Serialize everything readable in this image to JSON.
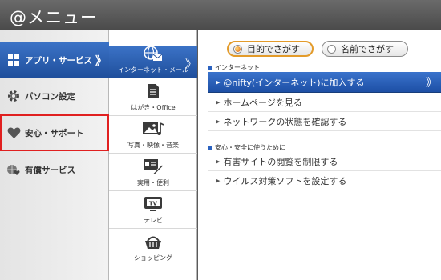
{
  "window": {
    "title": "@メニュー"
  },
  "sidebar": {
    "items": [
      {
        "label": "アプリ・サービス",
        "chevron": "》"
      },
      {
        "label": "パソコン設定"
      },
      {
        "label": "安心・サポート"
      },
      {
        "label": "有償サービス"
      }
    ]
  },
  "categories": [
    {
      "label": "インターネット・メール",
      "icon": "globe-mail-icon",
      "chevron": "》"
    },
    {
      "label": "はがき・Office",
      "icon": "document-icon"
    },
    {
      "label": "写真・映像・音楽",
      "icon": "photo-music-icon"
    },
    {
      "label": "実用・便利",
      "icon": "pen-card-icon"
    },
    {
      "label": "テレビ",
      "icon": "tv-icon"
    },
    {
      "label": "ショッピング",
      "icon": "shopping-basket-icon"
    }
  ],
  "search": {
    "purpose_label": "目的でさがす",
    "name_label": "名前でさがす"
  },
  "sections": [
    {
      "label": "インターネット",
      "items": [
        {
          "label": "@nifty(インターネット)に加入する",
          "chevron": "》"
        },
        {
          "label": "ホームページを見る"
        },
        {
          "label": "ネットワークの状態を確認する"
        }
      ]
    },
    {
      "label": "安心・安全に使うために",
      "items": [
        {
          "label": "有害サイトの閲覧を制限する"
        },
        {
          "label": "ウイルス対策ソフトを設定する"
        }
      ]
    }
  ],
  "colors": {
    "accent_blue": "#1f4f9c",
    "highlight_red": "#e02020",
    "radio_orange": "#e39b2a"
  }
}
